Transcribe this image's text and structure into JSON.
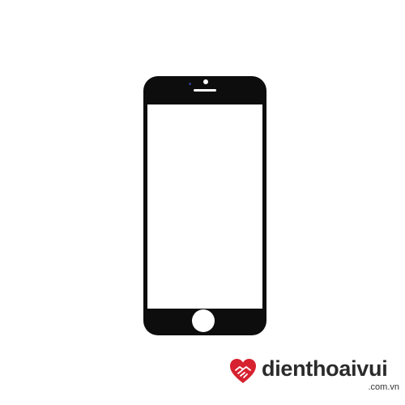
{
  "image": {
    "subject": "phone-front-glass-panel",
    "background_color": "#ffffff",
    "frame_color": "#0d0d0d"
  },
  "watermark": {
    "brand_name": "dienthoaivui",
    "domain": ".com.vn",
    "logo_icon": "heart-hands-icon",
    "logo_color": "#d7222f"
  }
}
